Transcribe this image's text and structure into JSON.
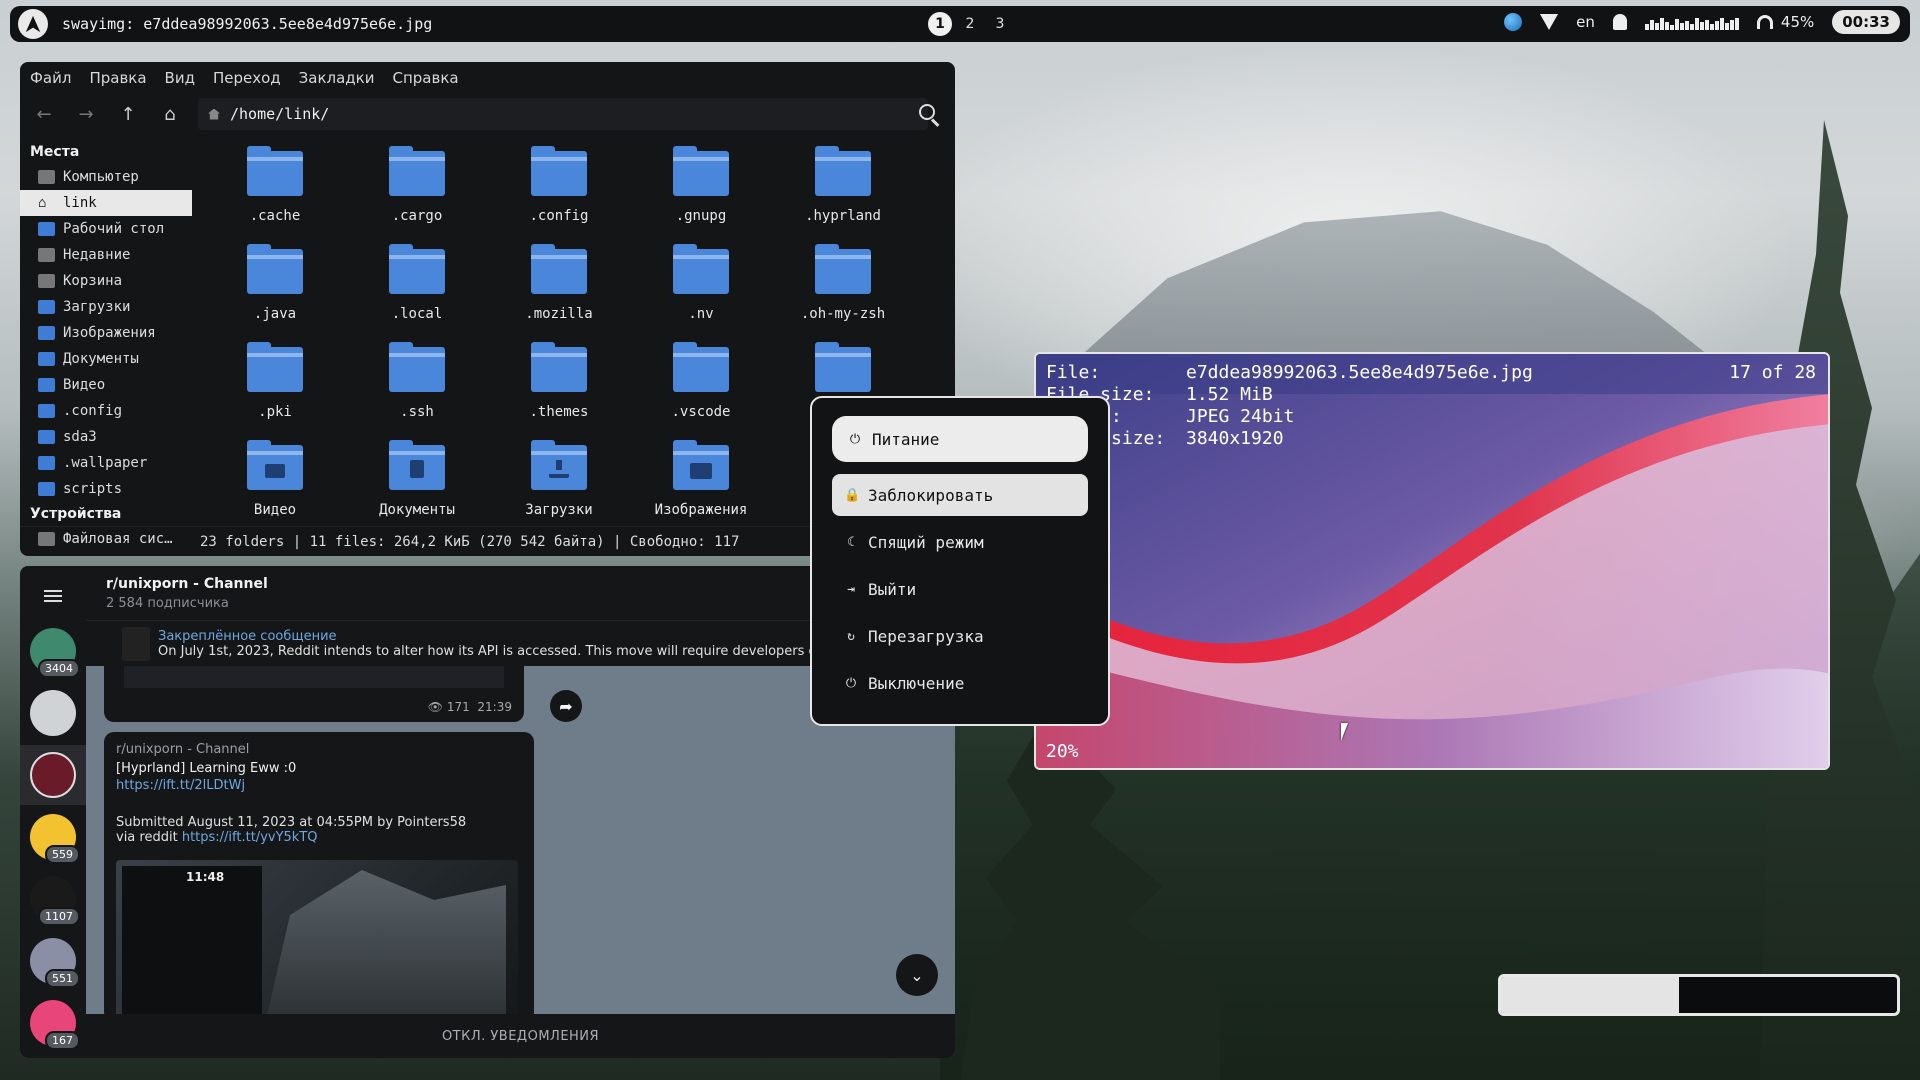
{
  "topbar": {
    "window_title": "swayimg: e7ddea98992063.5ee8e4d975e6e.jpg",
    "workspaces": [
      "1",
      "2",
      "3"
    ],
    "active_workspace": "1",
    "layout": "en",
    "volume": "45%",
    "clock": "00:33",
    "icons": [
      "arch-linux-icon",
      "globe-icon",
      "wifi-icon",
      "bell-icon",
      "audio-visualizer-icon",
      "headphones-icon"
    ]
  },
  "file_manager": {
    "menu": [
      "Файл",
      "Правка",
      "Вид",
      "Переход",
      "Закладки",
      "Справка"
    ],
    "path": "/home/link/",
    "places_heading": "Места",
    "places": [
      {
        "label": "Компьютер",
        "icon": "computer-icon"
      },
      {
        "label": "link",
        "icon": "home-icon",
        "active": true
      },
      {
        "label": "Рабочий стол",
        "icon": "desktop-folder-icon"
      },
      {
        "label": "Недавние",
        "icon": "clock-icon"
      },
      {
        "label": "Корзина",
        "icon": "trash-icon"
      },
      {
        "label": "Загрузки",
        "icon": "downloads-folder-icon"
      },
      {
        "label": "Изображения",
        "icon": "pictures-folder-icon"
      },
      {
        "label": "Документы",
        "icon": "documents-folder-icon"
      },
      {
        "label": "Видео",
        "icon": "videos-folder-icon"
      },
      {
        "label": ".config",
        "icon": "folder-icon"
      },
      {
        "label": "sda3",
        "icon": "folder-icon"
      },
      {
        "label": ".wallpaper",
        "icon": "folder-icon"
      },
      {
        "label": "scripts",
        "icon": "folder-icon"
      }
    ],
    "devices_heading": "Устройства",
    "devices": [
      {
        "label": "Файловая сис…",
        "icon": "drive-icon"
      }
    ],
    "files": [
      {
        "name": ".cache",
        "kind": "folder"
      },
      {
        "name": ".cargo",
        "kind": "folder"
      },
      {
        "name": ".config",
        "kind": "folder"
      },
      {
        "name": ".gnupg",
        "kind": "folder"
      },
      {
        "name": ".hyprland",
        "kind": "folder"
      },
      {
        "name": ".java",
        "kind": "folder"
      },
      {
        "name": ".local",
        "kind": "folder"
      },
      {
        "name": ".mozilla",
        "kind": "folder"
      },
      {
        "name": ".nv",
        "kind": "folder"
      },
      {
        "name": ".oh-my-zsh",
        "kind": "folder"
      },
      {
        "name": ".pki",
        "kind": "folder"
      },
      {
        "name": ".ssh",
        "kind": "folder"
      },
      {
        "name": ".themes",
        "kind": "folder"
      },
      {
        "name": ".vscode",
        "kind": "folder"
      },
      {
        "name": ".wa",
        "kind": "folder"
      },
      {
        "name": "Видео",
        "kind": "videos"
      },
      {
        "name": "Документы",
        "kind": "documents"
      },
      {
        "name": "Загрузки",
        "kind": "downloads"
      },
      {
        "name": "Изображения",
        "kind": "pictures"
      }
    ],
    "status": "23 folders  |  11 files: 264,2 КиБ (270 542 байта)  |  Свободно: 117"
  },
  "telegram": {
    "channel_title": "r/unixporn - Channel",
    "subscribers": "2 584 подписчика",
    "pinned_label": "Закреплённое сообщение",
    "pinned_text": "On July 1st, 2023, Reddit intends to alter how its API is accessed. This move will require developers of third-pa",
    "prev_views": "171",
    "prev_time": "21:39",
    "message": {
      "channel": "r/unixporn - Channel",
      "title": "[Hyprland] Learning Eww :0",
      "link": "https://ift.tt/2lLDtWj",
      "body": "Submitted August 11, 2023 at 04:55PM by Pointers58",
      "via": "via reddit",
      "via_link": "https://ift.tt/yvY5kTQ",
      "preview_time": "11:48"
    },
    "chats": [
      {
        "badge": "3404",
        "color": "#3f8a6f"
      },
      {
        "badge": "",
        "color": "#cfd3d6"
      },
      {
        "badge": "",
        "color": "#6a1b2a"
      },
      {
        "badge": "559",
        "color": "#f2c230"
      },
      {
        "badge": "1107",
        "color": "#1a1a1a"
      },
      {
        "badge": "551",
        "color": "#8a8fa6"
      },
      {
        "badge": "167",
        "color": "#e8457a"
      }
    ],
    "mute_label": "ОТКЛ. УВЕДОМЛЕНИЯ"
  },
  "viewer": {
    "file_key": "File:",
    "file": "e7ddea98992063.5ee8e4d975e6e.jpg",
    "filesize_key": "File size:",
    "filesize": "1.52 MiB",
    "format_key": "Format:",
    "format": "JPEG 24bit",
    "imgsize_key": "Image size:",
    "imgsize": "3840x1920",
    "index": "17 of 28",
    "zoom": "20%"
  },
  "power_menu": {
    "title": "Питание",
    "items": [
      {
        "label": "Заблокировать",
        "icon": "lock-icon",
        "glyph": "🔒",
        "selected": true
      },
      {
        "label": "Спящий режим",
        "icon": "moon-icon",
        "glyph": "☾",
        "selected": false
      },
      {
        "label": "Выйти",
        "icon": "logout-icon",
        "glyph": "⇥",
        "selected": false
      },
      {
        "label": "Перезагрузка",
        "icon": "restart-icon",
        "glyph": "↻",
        "selected": false
      },
      {
        "label": "Выключение",
        "icon": "power-icon",
        "glyph": "⏻",
        "selected": false
      }
    ]
  },
  "widget": {
    "progress": 0.45
  },
  "colors": {
    "folder_blue": "#4a86d9",
    "link_blue": "#6ea8e0",
    "panel_bg": "#141517"
  }
}
